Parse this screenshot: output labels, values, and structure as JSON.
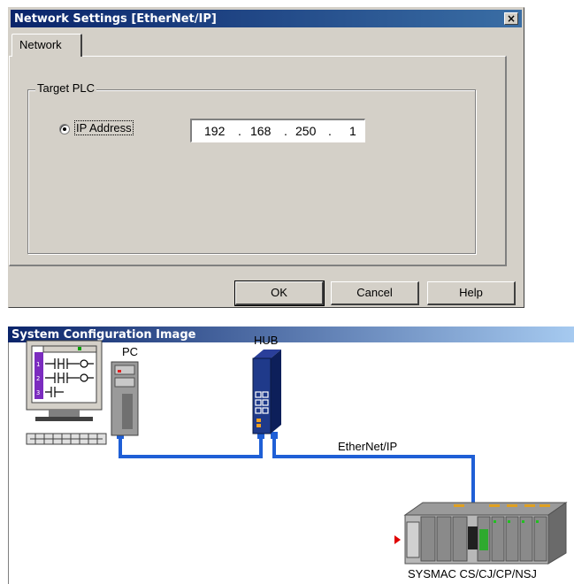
{
  "dialog": {
    "title": "Network Settings [EtherNet/IP]",
    "close_glyph": "×",
    "tab_label": "Network",
    "group_label": "Target PLC",
    "radio_label": "IP Address",
    "ip_octets": [
      "192",
      "168",
      "250",
      "1"
    ],
    "ip_separator": ".",
    "buttons": {
      "ok": "OK",
      "cancel": "Cancel",
      "help": "Help"
    }
  },
  "system_image": {
    "title": "System Configuration Image",
    "pc_label": "PC",
    "hub_label": "HUB",
    "link_label": "EtherNet/IP",
    "plc_label": "SYSMAC CS/CJ/CP/NSJ",
    "cable_color": "#1f5fd6"
  }
}
